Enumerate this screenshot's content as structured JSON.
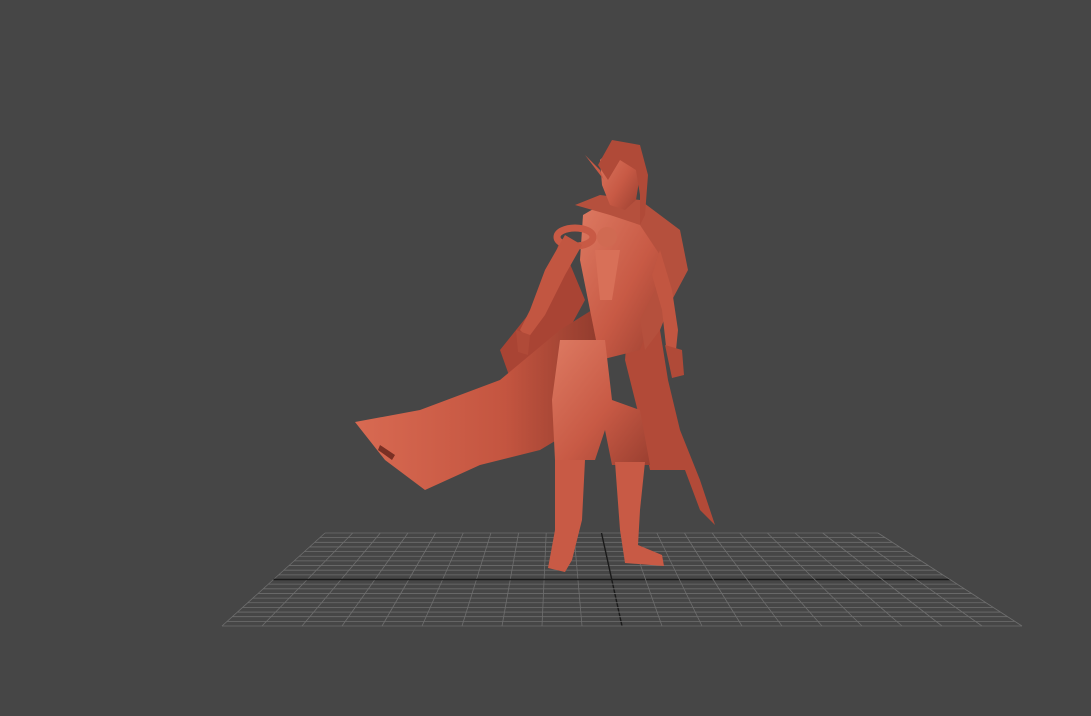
{
  "viewport": {
    "background": "#464646",
    "grid_color": "#6e6e6e",
    "grid_axis_color": "#1a1a1a",
    "model_color": "#c85a45",
    "model_shadow": "#9a3f30",
    "model_highlight": "#dd7a62"
  }
}
